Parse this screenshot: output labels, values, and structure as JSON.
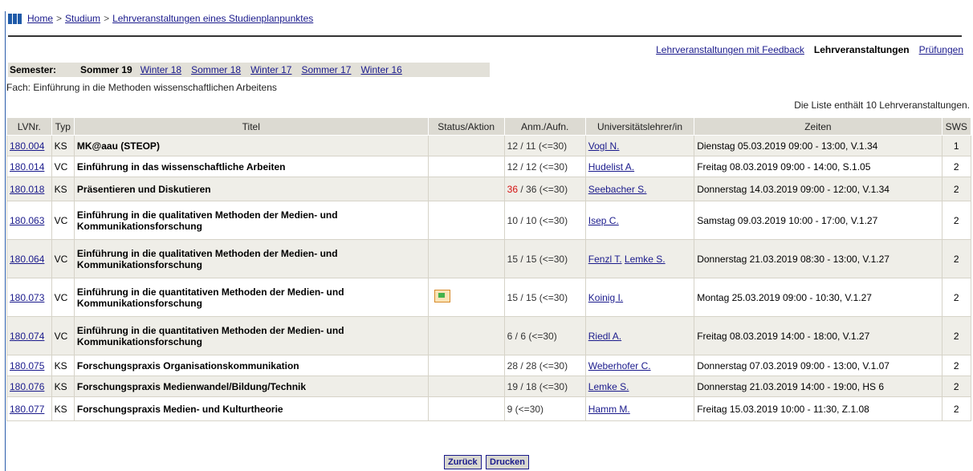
{
  "breadcrumb": {
    "items": [
      "Home",
      "Studium",
      "Lehrveranstaltungen eines Studienplanpunktes"
    ],
    "separator": ">"
  },
  "nav": {
    "feedback": "Lehrveranstaltungen mit Feedback",
    "courses": "Lehrveranstaltungen",
    "exams": "Prüfungen"
  },
  "semester": {
    "label": "Semester:",
    "current": "Sommer 19",
    "others": [
      "Winter 18",
      "Sommer 18",
      "Winter 17",
      "Sommer 17",
      "Winter 16"
    ]
  },
  "fach": "Fach: Einführung in die Methoden wissenschaftlichen Arbeitens",
  "count_text": "Die Liste enthält 10 Lehrveranstaltungen.",
  "table": {
    "headers": [
      "LVNr.",
      "Typ",
      "Titel",
      "Status/Aktion",
      "Anm./Aufn.",
      "Universitätslehrer/in",
      "Zeiten",
      "SWS"
    ],
    "rows": [
      {
        "nr": "180.004",
        "typ": "KS",
        "title": "MK@aau (STEOP)",
        "anm_red": "",
        "anm": "12 / 11  (<=30)",
        "teachers": [
          "Vogl N."
        ],
        "times": "Dienstag 05.03.2019 09:00 - 13:00, V.1.34",
        "sws": "1",
        "status_icon": false
      },
      {
        "nr": "180.014",
        "typ": "VC",
        "title": "Einführung in das wissenschaftliche Arbeiten",
        "anm_red": "",
        "anm": "12 / 12  (<=30)",
        "teachers": [
          "Hudelist A."
        ],
        "times": "Freitag 08.03.2019 09:00 - 14:00, S.1.05",
        "sws": "2",
        "status_icon": false
      },
      {
        "nr": "180.018",
        "typ": "KS",
        "title": "Präsentieren und Diskutieren",
        "anm_red": "36",
        "anm": " / 36  (<=30)",
        "teachers": [
          "Seebacher S."
        ],
        "times": "Donnerstag 14.03.2019 09:00 - 12:00, V.1.34",
        "sws": "2",
        "status_icon": false
      },
      {
        "nr": "180.063",
        "typ": "VC",
        "title": "Einführung in die qualitativen Methoden der Medien- und Kommunikationsforschung",
        "anm_red": "",
        "anm": "10 / 10  (<=30)",
        "teachers": [
          "Isep C."
        ],
        "times": "Samstag 09.03.2019 10:00 - 17:00, V.1.27",
        "sws": "2",
        "status_icon": false
      },
      {
        "nr": "180.064",
        "typ": "VC",
        "title": "Einführung in die qualitativen Methoden der Medien- und Kommunikationsforschung",
        "anm_red": "",
        "anm": "15 / 15  (<=30)",
        "teachers": [
          "Fenzl T.",
          "Lemke S."
        ],
        "times": "Donnerstag 21.03.2019 08:30 - 13:00, V.1.27",
        "sws": "2",
        "status_icon": false
      },
      {
        "nr": "180.073",
        "typ": "VC",
        "title": "Einführung in die quantitativen Methoden der Medien- und Kommunikationsforschung",
        "anm_red": "",
        "anm": "15 / 15  (<=30)",
        "teachers": [
          "Koinig I."
        ],
        "times": "Montag 25.03.2019 09:00 - 10:30, V.1.27",
        "sws": "2",
        "status_icon": true
      },
      {
        "nr": "180.074",
        "typ": "VC",
        "title": "Einführung in die quantitativen Methoden der Medien- und Kommunikationsforschung",
        "anm_red": "",
        "anm": "6 / 6  (<=30)",
        "teachers": [
          "Riedl A."
        ],
        "times": "Freitag 08.03.2019 14:00 - 18:00, V.1.27",
        "sws": "2",
        "status_icon": false
      },
      {
        "nr": "180.075",
        "typ": "KS",
        "title": "Forschungspraxis Organisationskommunikation",
        "anm_red": "",
        "anm": "28 / 28  (<=30)",
        "teachers": [
          "Weberhofer C."
        ],
        "times": "Donnerstag 07.03.2019 09:00 - 13:00, V.1.07",
        "sws": "2",
        "status_icon": false
      },
      {
        "nr": "180.076",
        "typ": "KS",
        "title": "Forschungspraxis Medienwandel/Bildung/Technik",
        "anm_red": "",
        "anm": "19 / 18  (<=30)",
        "teachers": [
          "Lemke S."
        ],
        "times": "Donnerstag 21.03.2019 14:00 - 19:00, HS 6",
        "sws": "2",
        "status_icon": false
      },
      {
        "nr": "180.077",
        "typ": "KS",
        "title": "Forschungspraxis Medien- und Kulturtheorie",
        "anm_red": "",
        "anm": "9  (<=30)",
        "teachers": [
          "Hamm M."
        ],
        "times": "Freitag 15.03.2019 10:00 - 11:30, Z.1.08",
        "sws": "2",
        "status_icon": false
      }
    ]
  },
  "buttons": {
    "back": "Zurück",
    "print": "Drucken"
  },
  "colors": {
    "link": "#1a1a8c",
    "header_bg": "#dcdad2",
    "row_odd": "#efeee8",
    "accent_red": "#d41111",
    "logo_blue": "#1f5aa8"
  }
}
